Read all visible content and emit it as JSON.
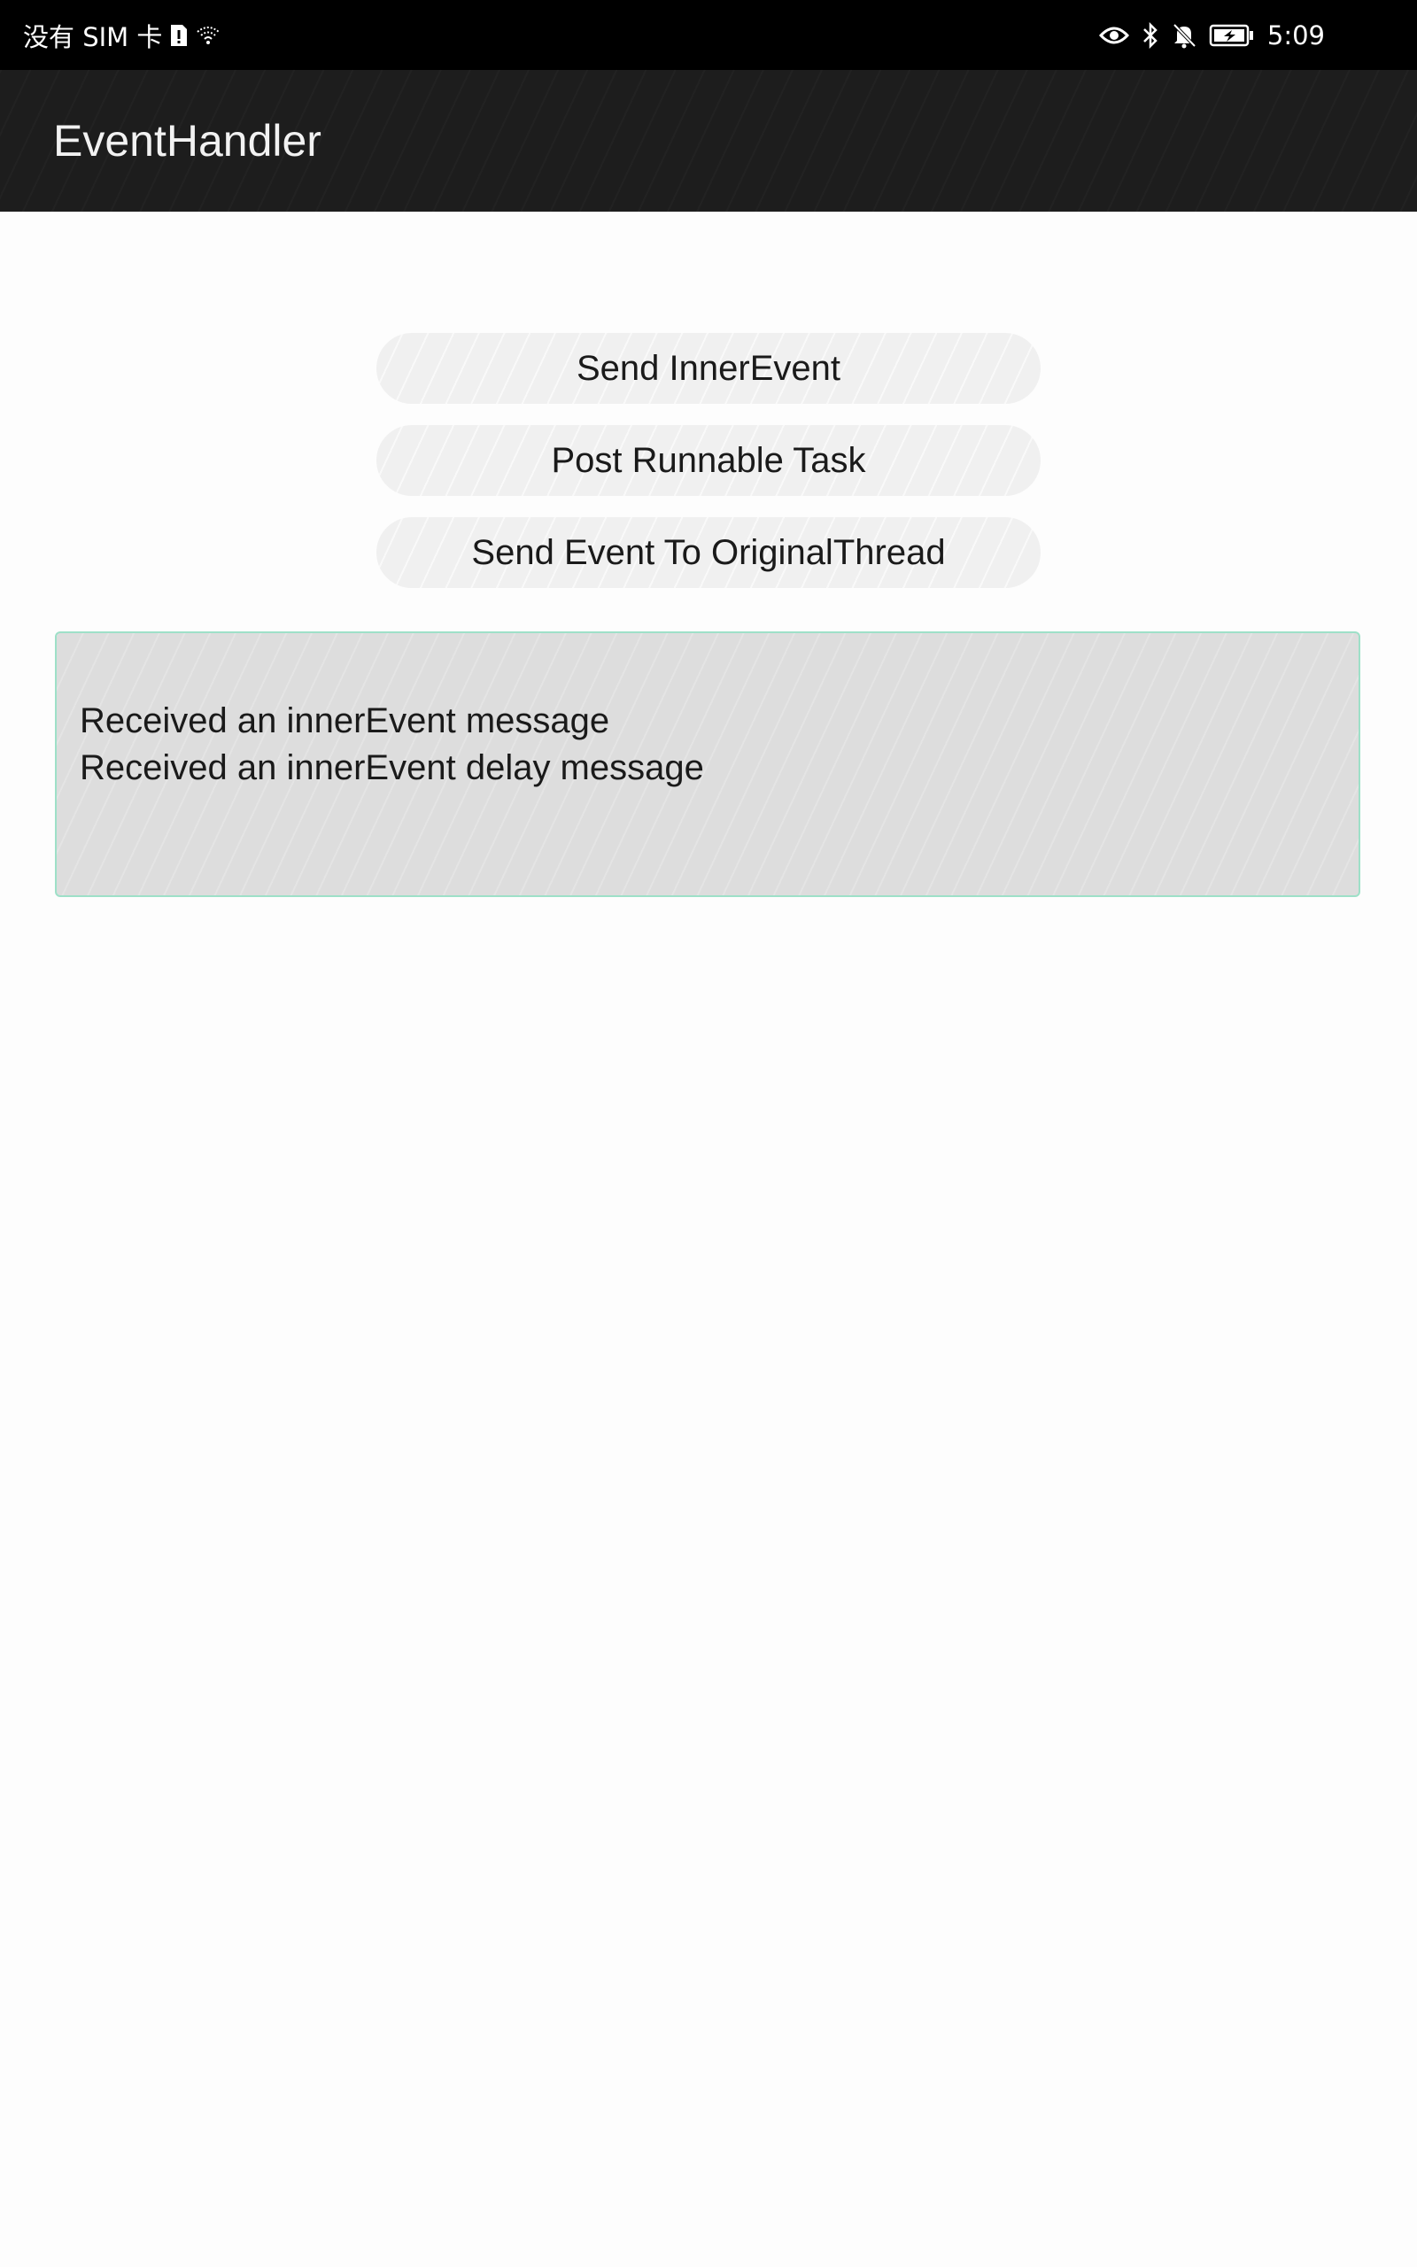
{
  "status_bar": {
    "carrier": "没有 SIM 卡",
    "time": "5:09",
    "icons": [
      "sim-alert-icon",
      "wifi-icon",
      "eye-icon",
      "bluetooth-icon",
      "bell-off-icon",
      "battery-charging-icon"
    ]
  },
  "app_bar": {
    "title": "EventHandler"
  },
  "buttons": {
    "send_inner_event": "Send InnerEvent",
    "post_runnable_task": "Post Runnable Task",
    "send_event_original_thread": "Send Event To OriginalThread"
  },
  "log": {
    "lines": [
      "Received an innerEvent message",
      "Received an innerEvent delay message"
    ]
  },
  "colors": {
    "status_bar_bg": "#000000",
    "app_bar_bg": "#1d1d1d",
    "button_bg": "#f0f0f0",
    "log_bg": "#dddddd",
    "log_border": "#9ee0c8"
  }
}
